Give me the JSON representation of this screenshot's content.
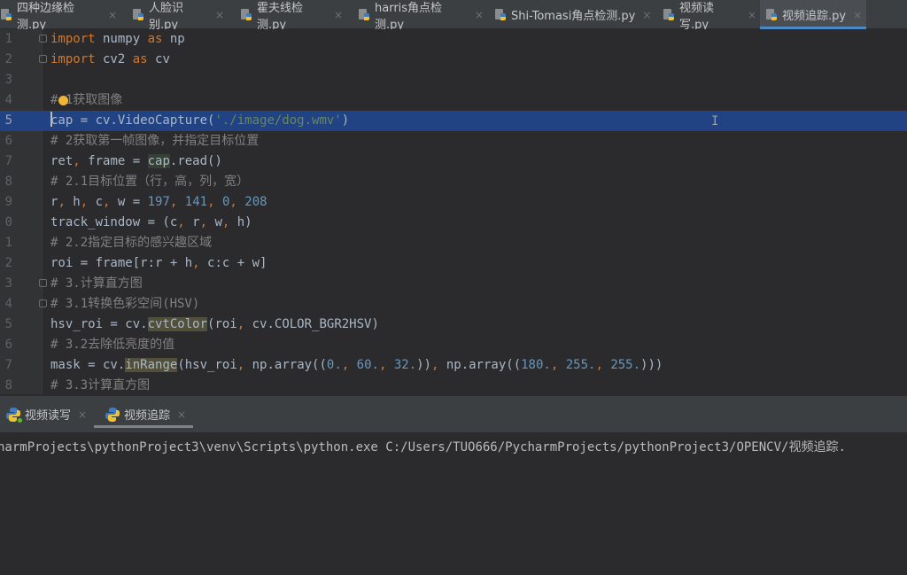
{
  "editor_tabs": [
    {
      "label": "四种边缘检测.py",
      "active": false
    },
    {
      "label": "人脸识别.py",
      "active": false
    },
    {
      "label": "霍夫线检测.py",
      "active": false
    },
    {
      "label": "harris角点检测.py",
      "active": false
    },
    {
      "label": "Shi-Tomasi角点检测.py",
      "active": false
    },
    {
      "label": "视频读写.py",
      "active": false
    },
    {
      "label": "视频追踪.py",
      "active": true
    }
  ],
  "tab_close_glyph": "×",
  "code": {
    "current_line": 5,
    "lines": [
      {
        "num": "1",
        "text": "import numpy as np"
      },
      {
        "num": "2",
        "text": "import cv2 as cv"
      },
      {
        "num": "3",
        "text": ""
      },
      {
        "num": "4",
        "text": "# 1获取图像"
      },
      {
        "num": "5",
        "text": "cap = cv.VideoCapture('./image/dog.wmv')"
      },
      {
        "num": "6",
        "text": "# 2获取第一帧图像，并指定目标位置"
      },
      {
        "num": "7",
        "text": "ret, frame = cap.read()"
      },
      {
        "num": "8",
        "text": "# 2.1目标位置（行，高，列，宽）"
      },
      {
        "num": "9",
        "text": "r, h, c, w = 197, 141, 0, 208"
      },
      {
        "num": "0",
        "text": "track_window = (c, r, w, h)"
      },
      {
        "num": "1",
        "text": "# 2.2指定目标的感兴趣区域"
      },
      {
        "num": "2",
        "text": "roi = frame[r:r + h, c:c + w]"
      },
      {
        "num": "3",
        "text": "# 3.计算直方图"
      },
      {
        "num": "4",
        "text": "# 3.1转换色彩空间(HSV)"
      },
      {
        "num": "5",
        "text": "hsv_roi = cv.cvtColor(roi, cv.COLOR_BGR2HSV)"
      },
      {
        "num": "6",
        "text": "# 3.2去除低亮度的值"
      },
      {
        "num": "7",
        "text": "mask = cv.inRange(hsv_roi, np.array((0., 60., 32.)), np.array((180., 255., 255.)))"
      },
      {
        "num": "8",
        "text": "# 3.3计算直方图"
      }
    ]
  },
  "run_tabs": [
    {
      "label": "视频读写",
      "active": false
    },
    {
      "label": "视频追踪",
      "active": true
    }
  ],
  "console": {
    "output": "harmProjects\\pythonProject3\\venv\\Scripts\\python.exe C:/Users/TUO666/PycharmProjects/pythonProject3/OPENCV/视频追踪."
  },
  "mouse_cursor_glyph": "I",
  "colors": {
    "accent": "#4a88c7",
    "selection": "#214283",
    "keyword": "#cc7832",
    "number": "#6897bb",
    "string": "#6a8759",
    "comment": "#808080"
  }
}
